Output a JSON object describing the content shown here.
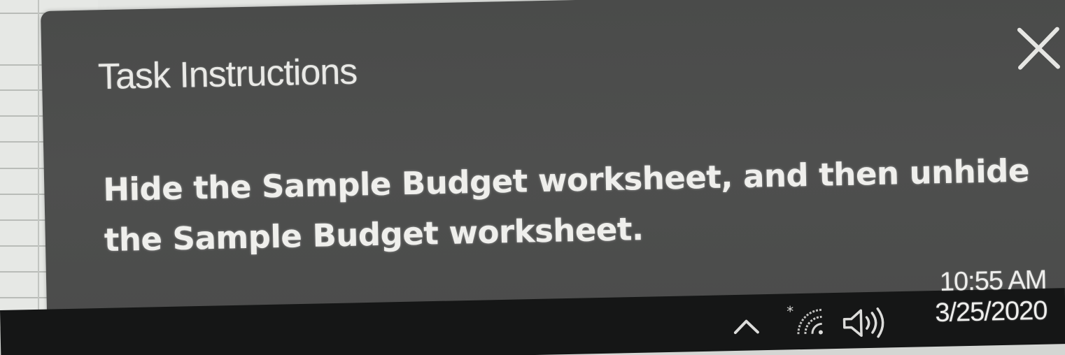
{
  "panel": {
    "title": "Task Instructions",
    "instruction": "Hide the Sample Budget worksheet, and then unhide the Sample Budget worksheet.",
    "background_color": "#4b4c4b",
    "text_color": "#efefec"
  },
  "taskbar": {
    "time": "10:55 AM",
    "date": "3/25/2020",
    "icons": [
      "chevron-up-icon",
      "wifi-icon",
      "speaker-icon"
    ],
    "background_color": "#151616"
  }
}
